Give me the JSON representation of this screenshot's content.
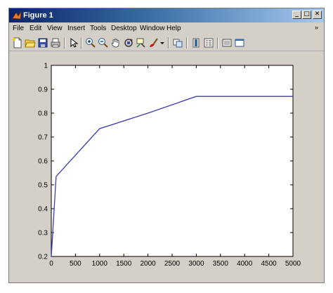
{
  "window": {
    "title": "Figure 1",
    "minimize_glyph": "_",
    "maximize_glyph": "□",
    "close_glyph": "✕"
  },
  "menu": {
    "items": [
      {
        "label": "File"
      },
      {
        "label": "Edit"
      },
      {
        "label": "View"
      },
      {
        "label": "Insert"
      },
      {
        "label": "Tools"
      },
      {
        "label": "Desktop"
      },
      {
        "label": "Window"
      },
      {
        "label": "Help"
      }
    ],
    "overflow_glyph": "»"
  },
  "toolbar": {
    "icons": [
      "new-figure-icon",
      "open-file-icon",
      "save-icon",
      "print-icon",
      "select-arrow-icon",
      "zoom-in-icon",
      "zoom-out-icon",
      "pan-hand-icon",
      "rotate-3d-icon",
      "data-cursor-icon",
      "brush-icon",
      "brush-dropdown-icon",
      "link-plot-icon",
      "insert-colorbar-icon",
      "insert-legend-icon",
      "hide-plot-tools-icon",
      "show-plot-tools-icon"
    ]
  },
  "colors": {
    "line": "#3b3bb0",
    "axes_bg": "#ffffff",
    "figure_bg": "#d4d0c8"
  },
  "chart_data": {
    "type": "line",
    "title": "",
    "xlabel": "",
    "ylabel": "",
    "xlim": [
      0,
      5000
    ],
    "ylim": [
      0.2,
      1
    ],
    "grid": false,
    "xticks": [
      0,
      500,
      1000,
      1500,
      2000,
      2500,
      3000,
      3500,
      4000,
      4500,
      5000
    ],
    "yticks": [
      0.2,
      0.3,
      0.4,
      0.5,
      0.6,
      0.7,
      0.8,
      0.9,
      1
    ],
    "xticklabels": [
      "0",
      "500",
      "1000",
      "1500",
      "2000",
      "2500",
      "3000",
      "3500",
      "4000",
      "4500",
      "5000"
    ],
    "yticklabels": [
      "0.2",
      "0.3",
      "0.4",
      "0.5",
      "0.6",
      "0.7",
      "0.8",
      "0.9",
      "1"
    ],
    "series": [
      {
        "x": [
          0,
          100,
          1000,
          2000,
          3000,
          4000,
          5000
        ],
        "y": [
          0.2,
          0.535,
          0.735,
          0.8,
          0.87,
          0.87,
          0.87
        ]
      }
    ]
  }
}
